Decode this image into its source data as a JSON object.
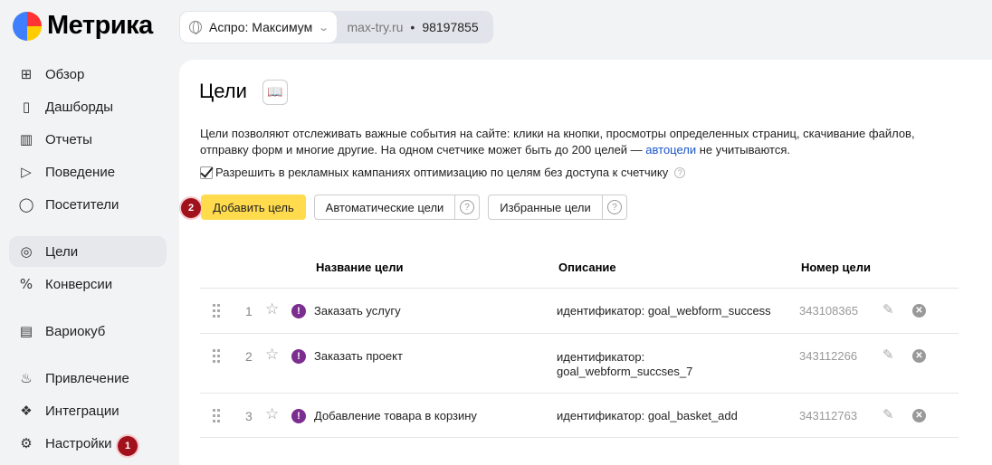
{
  "app": {
    "logo_text": "Метрика"
  },
  "counter": {
    "name": "Аспро: Максимум",
    "site": "max-try.ru",
    "separator": "•",
    "id": "98197855"
  },
  "sidebar": {
    "items": [
      {
        "label": "Обзор",
        "icon": "grid-icon"
      },
      {
        "label": "Дашборды",
        "icon": "dashboard-icon"
      },
      {
        "label": "Отчеты",
        "icon": "reports-icon"
      },
      {
        "label": "Поведение",
        "icon": "play-icon"
      },
      {
        "label": "Посетители",
        "icon": "user-icon"
      },
      {
        "label": "Цели",
        "icon": "target-icon",
        "active": true
      },
      {
        "label": "Конверсии",
        "icon": "percent-icon"
      },
      {
        "label": "Вариокуб",
        "icon": "variocube-icon"
      },
      {
        "label": "Привлечение",
        "icon": "flame-icon"
      },
      {
        "label": "Интеграции",
        "icon": "puzzle-icon"
      },
      {
        "label": "Настройки",
        "icon": "gear-icon"
      }
    ],
    "settings_badge": "1"
  },
  "main": {
    "title": "Цели",
    "description_part1": "Цели позволяют отслеживать важные события на сайте: клики на кнопки, просмотры определенных страниц, скачивание файлов,",
    "description_part2": "отправку форм и многие другие. На одном счетчике может быть до 200 целей — ",
    "description_link": "автоцели",
    "description_part3": " не учитываются.",
    "checkbox_label": "Разрешить в рекламных кампаниях оптимизацию по целям без доступа к счетчику",
    "checkbox_checked": true,
    "add_badge": "2",
    "buttons": {
      "add": "Добавить цель",
      "auto": "Автоматические цели",
      "favorites": "Избранные цели"
    },
    "table": {
      "headers": {
        "name": "Название цели",
        "description": "Описание",
        "number": "Номер цели"
      },
      "rows": [
        {
          "index": "1",
          "name": "Заказать услугу",
          "desc_line1": "идентификатор: goal_webform_success",
          "desc_line2": "",
          "id": "343108365"
        },
        {
          "index": "2",
          "name": "Заказать проект",
          "desc_line1": "идентификатор:",
          "desc_line2": "goal_webform_succses_7",
          "id": "343112266"
        },
        {
          "index": "3",
          "name": "Добавление товара в корзину",
          "desc_line1": "идентификатор: goal_basket_add",
          "desc_line2": "",
          "id": "343112763"
        }
      ]
    }
  },
  "colors": {
    "primary_button": "#ffdb4d",
    "badge": "#a0111c",
    "warn_icon": "#7b2e8f",
    "link": "#1a55c8"
  }
}
